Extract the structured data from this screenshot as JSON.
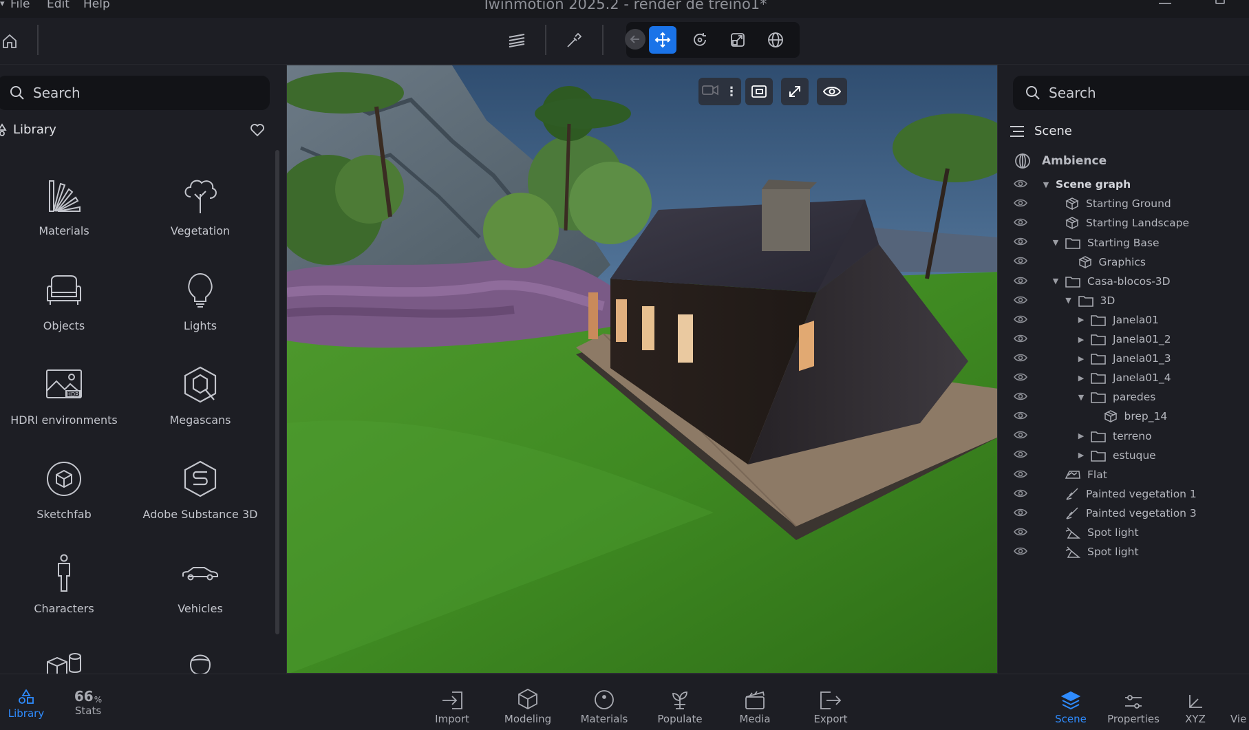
{
  "window": {
    "title": "Twinmotion 2025.2 - render de treino1*"
  },
  "menu": [
    "File",
    "Edit",
    "Help"
  ],
  "toolbar": {
    "icons": [
      "home-icon",
      "layers-icon",
      "eyedropper-icon",
      "back-arrow-icon",
      "move-icon",
      "rotate-icon",
      "scale-icon",
      "globe-icon"
    ]
  },
  "library": {
    "search_placeholder": "Search",
    "title": "Library",
    "items": [
      {
        "label": "Materials",
        "icon": "materials-fan-icon"
      },
      {
        "label": "Vegetation",
        "icon": "tree-icon"
      },
      {
        "label": "Objects",
        "icon": "sofa-icon"
      },
      {
        "label": "Lights",
        "icon": "bulb-icon"
      },
      {
        "label": "HDRI environments",
        "icon": "hdri-icon"
      },
      {
        "label": "Megascans",
        "icon": "megascans-icon"
      },
      {
        "label": "Sketchfab",
        "icon": "sketchfab-icon"
      },
      {
        "label": "Adobe Substance 3D",
        "icon": "substance-icon"
      },
      {
        "label": "Characters",
        "icon": "person-icon"
      },
      {
        "label": "Vehicles",
        "icon": "car-icon"
      }
    ]
  },
  "scene": {
    "search_placeholder": "Search",
    "title": "Scene",
    "ambience": "Ambience",
    "rows": [
      {
        "label": "Scene graph",
        "depth": 0,
        "expander": "down",
        "icon": "none",
        "bold": true
      },
      {
        "label": "Starting Ground",
        "depth": 1,
        "expander": "none",
        "icon": "mesh"
      },
      {
        "label": "Starting Landscape",
        "depth": 1,
        "expander": "none",
        "icon": "mesh"
      },
      {
        "label": "Starting Base",
        "depth": 1,
        "expander": "down",
        "icon": "folder"
      },
      {
        "label": "Graphics",
        "depth": 2,
        "expander": "none",
        "icon": "mesh"
      },
      {
        "label": "Casa-blocos-3D",
        "depth": 1,
        "expander": "down",
        "icon": "folder"
      },
      {
        "label": "3D",
        "depth": 2,
        "expander": "down",
        "icon": "folder"
      },
      {
        "label": "Janela01",
        "depth": 3,
        "expander": "right",
        "icon": "folder"
      },
      {
        "label": "Janela01_2",
        "depth": 3,
        "expander": "right",
        "icon": "folder"
      },
      {
        "label": "Janela01_3",
        "depth": 3,
        "expander": "right",
        "icon": "folder"
      },
      {
        "label": "Janela01_4",
        "depth": 3,
        "expander": "right",
        "icon": "folder"
      },
      {
        "label": "paredes",
        "depth": 3,
        "expander": "down",
        "icon": "folder"
      },
      {
        "label": "brep_14",
        "depth": 4,
        "expander": "none",
        "icon": "mesh"
      },
      {
        "label": "terreno",
        "depth": 3,
        "expander": "right",
        "icon": "folder"
      },
      {
        "label": "estuque",
        "depth": 3,
        "expander": "right",
        "icon": "folder"
      },
      {
        "label": "Flat",
        "depth": 1,
        "expander": "none",
        "icon": "flat"
      },
      {
        "label": "Painted vegetation 1",
        "depth": 1,
        "expander": "none",
        "icon": "brush"
      },
      {
        "label": "Painted vegetation 3",
        "depth": 1,
        "expander": "none",
        "icon": "brush"
      },
      {
        "label": "Spot light",
        "depth": 1,
        "expander": "none",
        "icon": "spot"
      },
      {
        "label": "Spot light",
        "depth": 1,
        "expander": "none",
        "icon": "spot"
      }
    ]
  },
  "bottom": {
    "library": "Library",
    "stats_value": "66",
    "stats_unit": "%",
    "stats_label": "Stats",
    "center": [
      "Import",
      "Modeling",
      "Materials",
      "Populate",
      "Media",
      "Export"
    ],
    "right": [
      "Scene",
      "Properties",
      "XYZ",
      "Vie"
    ]
  },
  "colors": {
    "accent": "#2f8cff",
    "background": "#1d1e24",
    "panel_dark": "#121317"
  }
}
